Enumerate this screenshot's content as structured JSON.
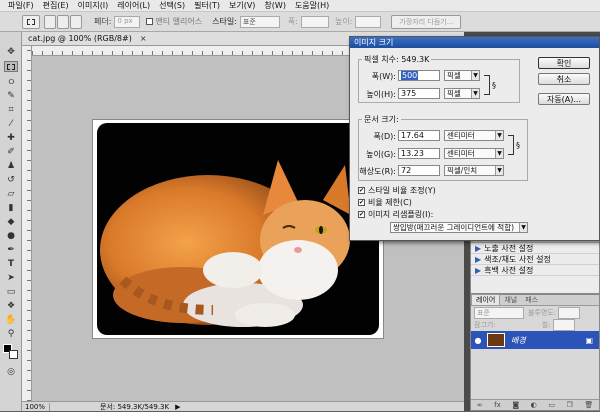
{
  "menu": [
    "파일(F)",
    "편집(E)",
    "이미지(I)",
    "레이어(L)",
    "선택(S)",
    "필터(T)",
    "보기(V)",
    "창(W)",
    "도움말(H)"
  ],
  "options": {
    "feather_label": "페더:",
    "feather_value": "0 px",
    "antialias_label": "앤티 앨리어스",
    "style_label": "스타일:",
    "style_value": "표준",
    "width_label": "폭:",
    "height_label": "높이:",
    "refine_edge": "가장자리 다듬기..."
  },
  "document": {
    "tab": "cat.jpg @ 100% (RGB/8#)",
    "zoom": "100%",
    "doc_size": "문서: 549.3K/549.3K"
  },
  "dialog": {
    "title": "이미지 크기",
    "pixel_dims_label": "픽셀 치수: 549.3K",
    "pixel_width_label": "폭(W):",
    "pixel_width_value": "500",
    "pixel_width_unit": "픽셀",
    "pixel_height_label": "높이(H):",
    "pixel_height_value": "375",
    "pixel_height_unit": "픽셀",
    "doc_size_label": "문서 크기:",
    "doc_width_label": "폭(D):",
    "doc_width_value": "17.64",
    "doc_width_unit": "센티미터",
    "doc_height_label": "높이(G):",
    "doc_height_value": "13.23",
    "doc_height_unit": "센티미터",
    "resolution_label": "해상도(R):",
    "resolution_value": "72",
    "resolution_unit": "픽셀/인치",
    "scale_styles": "스타일 비율 조정(Y)",
    "constrain": "비율 제한(C)",
    "resample": "이미지 리샘플링(I):",
    "resample_method": "쌍입방(매끄러운 그레이디언트에 적합)",
    "ok": "확인",
    "cancel": "취소",
    "auto": "자동(A)..."
  },
  "adjustments": [
    "노출 사전 설정",
    "색조/채도 사전 설정",
    "흑백 사전 설정"
  ],
  "layers": {
    "tabs": [
      "레이어",
      "채널",
      "패스"
    ],
    "blend_mode": "표준",
    "opacity_label": "불투명도:",
    "lock_label": "잠그기:",
    "fill_label": "칠:",
    "layer_name": "배경"
  },
  "colors": {
    "accent": "#1d4d9e",
    "selected_layer": "#2b53b8"
  }
}
